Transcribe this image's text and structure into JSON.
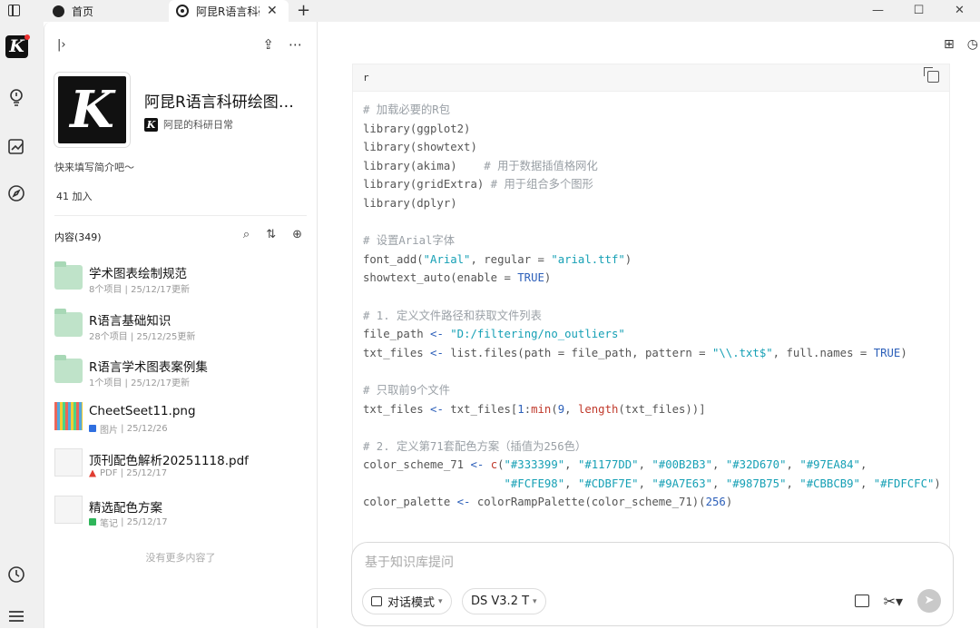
{
  "titlebar": {
    "tabs": [
      {
        "label": "首页"
      },
      {
        "label": "阿昆R语言科研"
      }
    ],
    "new_tab_symbol": "+",
    "window_buttons": {
      "minimize": "—",
      "maximize": "☐",
      "close": "✕"
    }
  },
  "rail": {
    "logo_text": "K",
    "items": [
      "lightbulb-icon",
      "edit-chart-icon",
      "compass-icon",
      "clock-icon",
      "menu-icon"
    ]
  },
  "kb": {
    "cover_text": "K",
    "title": "阿昆R语言科研绘图知识库",
    "author_logo": "K",
    "author": "阿昆的科研日常",
    "description": "快来填写简介吧～",
    "joined": "41 加入",
    "content_heading": "内容(349)",
    "no_more": "没有更多内容了"
  },
  "items": [
    {
      "name": "学术图表绘制规范",
      "meta": "8个项目 | 25/12/17更新",
      "kind": "folder"
    },
    {
      "name": "R语言基础知识",
      "meta": "28个项目 | 25/12/25更新",
      "kind": "folder"
    },
    {
      "name": "R语言学术图表案例集",
      "meta": "1个项目 | 25/12/17更新",
      "kind": "folder"
    },
    {
      "name": "CheetSeet11.png",
      "type_label": "图片",
      "date": "25/12/26",
      "kind": "image",
      "type_color": "#2f6fe0"
    },
    {
      "name": "顶刊配色解析20251118.pdf",
      "type_label": "PDF",
      "date": "25/12/17",
      "kind": "pdf",
      "type_color": "#e03c31"
    },
    {
      "name": "精选配色方案",
      "type_label": "笔记",
      "date": "25/12/17",
      "kind": "note",
      "type_color": "#2fb55a"
    }
  ],
  "code": {
    "lang": "r",
    "lines": [
      [
        [
          "c",
          "# 加载必要的R包"
        ]
      ],
      [
        [
          "",
          "library(ggplot2)"
        ]
      ],
      [
        [
          "",
          "library(showtext)"
        ]
      ],
      [
        [
          "",
          "library(akima)    "
        ],
        [
          "c",
          "# 用于数据插值格网化"
        ]
      ],
      [
        [
          "",
          "library(gridExtra) "
        ],
        [
          "c",
          "# 用于组合多个图形"
        ]
      ],
      [
        [
          "",
          "library(dplyr)"
        ]
      ],
      [
        [
          "",
          ""
        ]
      ],
      [
        [
          "c",
          "# 设置Arial字体"
        ]
      ],
      [
        [
          "",
          "font_add("
        ],
        [
          "s",
          "\"Arial\""
        ],
        [
          "",
          ", regular = "
        ],
        [
          "s",
          "\"arial.ttf\""
        ],
        [
          "",
          ")"
        ]
      ],
      [
        [
          "",
          "showtext_auto(enable = "
        ],
        [
          "k",
          "TRUE"
        ],
        [
          "",
          ")"
        ]
      ],
      [
        [
          "",
          ""
        ]
      ],
      [
        [
          "c",
          "# 1. 定义文件路径和获取文件列表"
        ]
      ],
      [
        [
          "",
          "file_path "
        ],
        [
          "k",
          "<-"
        ],
        [
          "",
          " "
        ],
        [
          "s",
          "\"D:/filtering/no_outliers\""
        ]
      ],
      [
        [
          "",
          "txt_files "
        ],
        [
          "k",
          "<-"
        ],
        [
          "",
          " list.files(path = file_path, pattern = "
        ],
        [
          "s",
          "\"\\\\.txt$\""
        ],
        [
          "",
          ", full.names = "
        ],
        [
          "k",
          "TRUE"
        ],
        [
          "",
          ")"
        ]
      ],
      [
        [
          "",
          ""
        ]
      ],
      [
        [
          "c",
          "# 只取前9个文件"
        ]
      ],
      [
        [
          "",
          "txt_files "
        ],
        [
          "k",
          "<-"
        ],
        [
          "",
          " txt_files["
        ],
        [
          "k",
          "1"
        ],
        [
          "",
          ":"
        ],
        [
          "f",
          "min"
        ],
        [
          "",
          "("
        ],
        [
          "k",
          "9"
        ],
        [
          "",
          ", "
        ],
        [
          "f",
          "length"
        ],
        [
          "",
          "(txt_files))]"
        ]
      ],
      [
        [
          "",
          ""
        ]
      ],
      [
        [
          "c",
          "# 2. 定义第71套配色方案（插值为256色）"
        ]
      ],
      [
        [
          "",
          "color_scheme_71 "
        ],
        [
          "k",
          "<-"
        ],
        [
          "",
          " "
        ],
        [
          "f",
          "c"
        ],
        [
          "",
          "("
        ],
        [
          "s",
          "\"#333399\""
        ],
        [
          "",
          ", "
        ],
        [
          "s",
          "\"#1177DD\""
        ],
        [
          "",
          ", "
        ],
        [
          "s",
          "\"#00B2B3\""
        ],
        [
          "",
          ", "
        ],
        [
          "s",
          "\"#32D670\""
        ],
        [
          "",
          ", "
        ],
        [
          "s",
          "\"#97EA84\""
        ],
        [
          "",
          ","
        ]
      ],
      [
        [
          "",
          "                     "
        ],
        [
          "s",
          "\"#FCFE98\""
        ],
        [
          "",
          ", "
        ],
        [
          "s",
          "\"#CDBF7E\""
        ],
        [
          "",
          ", "
        ],
        [
          "s",
          "\"#9A7E63\""
        ],
        [
          "",
          ", "
        ],
        [
          "s",
          "\"#987B75\""
        ],
        [
          "",
          ", "
        ],
        [
          "s",
          "\"#CBBCB9\""
        ],
        [
          "",
          ", "
        ],
        [
          "s",
          "\"#FDFCFC\""
        ],
        [
          "",
          ")"
        ]
      ],
      [
        [
          "",
          "color_palette "
        ],
        [
          "k",
          "<-"
        ],
        [
          "",
          " colorRampPalette(color_scheme_71)("
        ],
        [
          "k",
          "256"
        ],
        [
          "",
          ")"
        ]
      ]
    ]
  },
  "composer": {
    "placeholder": "基于知识库提问",
    "mode_label": "对话模式",
    "model_label": "DS V3.2 T"
  }
}
